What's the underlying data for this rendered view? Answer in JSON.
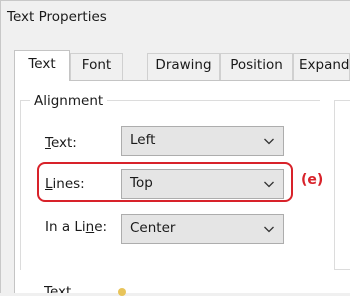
{
  "window": {
    "title": "Text Properties"
  },
  "tabs": [
    {
      "label": "Text",
      "active": true
    },
    {
      "label": "Font"
    },
    {
      "label": "Drawing"
    },
    {
      "label": "Position"
    },
    {
      "label": "Expand"
    }
  ],
  "alignment": {
    "legend": "Alignment",
    "text_field": {
      "label_prefix": "",
      "label_mnemonic": "T",
      "label_rest": "ext:",
      "value": "Left"
    },
    "lines_field": {
      "label_prefix": "",
      "label_mnemonic": "L",
      "label_rest": "ines:",
      "value": "Top"
    },
    "inline_field": {
      "label_prefix": "In a Li",
      "label_mnemonic": "n",
      "label_rest": "e:",
      "value": "Center"
    }
  },
  "annotation": {
    "callout": "(e)",
    "color": "#d8222a"
  },
  "partial_label": "Text ..."
}
